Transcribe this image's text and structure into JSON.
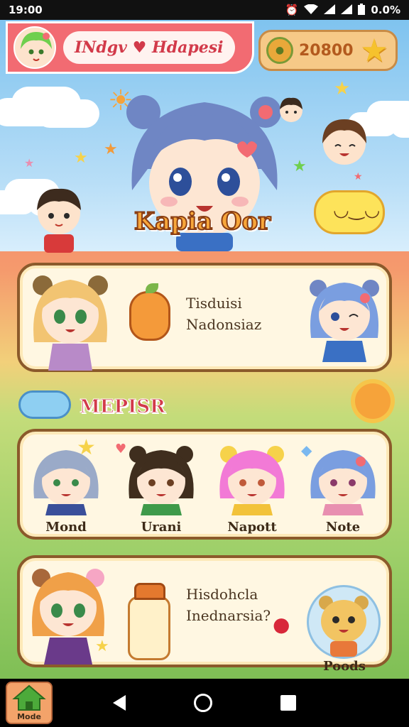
{
  "status_bar": {
    "time": "19:00",
    "battery": "0.0%",
    "icons": [
      "alarm-icon",
      "wifi-icon",
      "signal-icon",
      "signal-icon",
      "battery-icon"
    ]
  },
  "header": {
    "profile_name": "INdgv ♥ Hdapesi",
    "coins": "20800"
  },
  "hero": {
    "title": "Kapia Oor"
  },
  "card_one": {
    "line1": "Tisduisi",
    "line2": "Nadonsiaz"
  },
  "members_section": {
    "title": "MEPISR",
    "members": [
      {
        "label": "Mond",
        "hair": "#9aaac8",
        "shirt": "#3a4f9a"
      },
      {
        "label": "Urani",
        "hair": "#3f2e1e",
        "shirt": "#3f9a4a"
      },
      {
        "label": "Napott",
        "hair": "#f27ad6",
        "shirt": "#f2c23a"
      },
      {
        "label": "Note",
        "hair": "#7a9ee0",
        "shirt": "#e88fb0"
      }
    ]
  },
  "card_three": {
    "line1": "Hisdohcla",
    "line2": "Inednarsia?",
    "circle_label": "Poods"
  },
  "nav": {
    "home_label": "Mode"
  }
}
